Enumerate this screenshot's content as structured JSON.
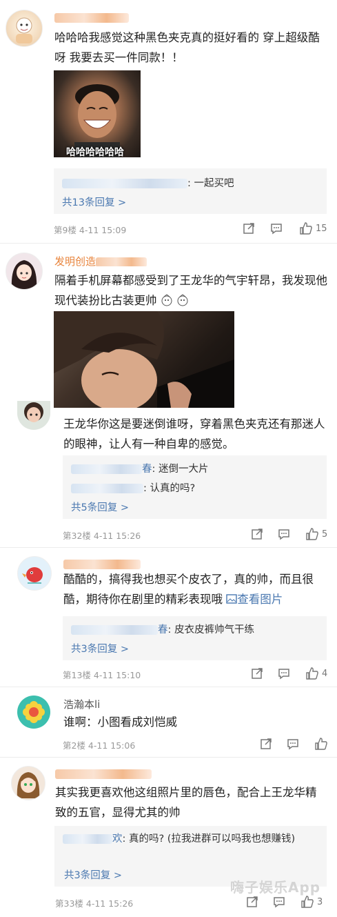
{
  "comments": [
    {
      "text": "哈哈哈我感觉这种黑色夹克真的挺好看的 穿上超级酷呀 我要去买一件同款！！",
      "image_caption": "哈哈哈哈哈哈",
      "reply": {
        "text": ": 一起买吧"
      },
      "more_replies": "共13条回复 >",
      "meta": "第9楼 4-11 15:09",
      "likes": "15"
    },
    {
      "name_partial": "发明创造",
      "text": "隔着手机屏幕都感受到了王龙华的气宇轩昂，我发现他现代装扮比古装更帅"
    },
    {
      "text": "王龙华你这是要迷倒谁呀，穿着黑色夹克还有那迷人的眼神，让人有一种自卑的感觉。",
      "replies": [
        {
          "suffix": "春",
          "text": ": 迷倒一大片"
        },
        {
          "text": ": 认真的吗?"
        }
      ],
      "more_replies": "共5条回复 >",
      "meta": "第32楼 4-11 15:26",
      "likes": "5"
    },
    {
      "text": "酷酷的，搞得我也想买个皮衣了，真的帅，而且很酷，期待你在剧里的精彩表现哦",
      "view_image": "查看图片",
      "reply": {
        "suffix": "春",
        "text": ": 皮衣皮裤帅气干练"
      },
      "more_replies": "共3条回复 >",
      "meta": "第13楼 4-11 15:10",
      "likes": "4"
    },
    {
      "name": "浩瀚本li",
      "text": "谁啊：小图看成刘恺威",
      "meta": "第2楼 4-11 15:06"
    },
    {
      "text": "其实我更喜欢他这组照片里的唇色，配合上王龙华精致的五官，显得尤其的帅",
      "reply": {
        "suffix": "欢",
        "text": ": 真的吗? (拉我进群可以吗我也想赚钱)"
      },
      "more_replies": "共3条回复 >",
      "meta": "第33楼 4-11 15:26",
      "likes": "3"
    }
  ],
  "watermark": "嗨子娱乐App",
  "colors": {
    "username": "#e8843c",
    "link": "#4a78b0",
    "meta": "#999999",
    "reply_bg": "#f5f5f5"
  },
  "icons": [
    "share-icon",
    "comment-icon",
    "like-icon",
    "image-icon"
  ]
}
